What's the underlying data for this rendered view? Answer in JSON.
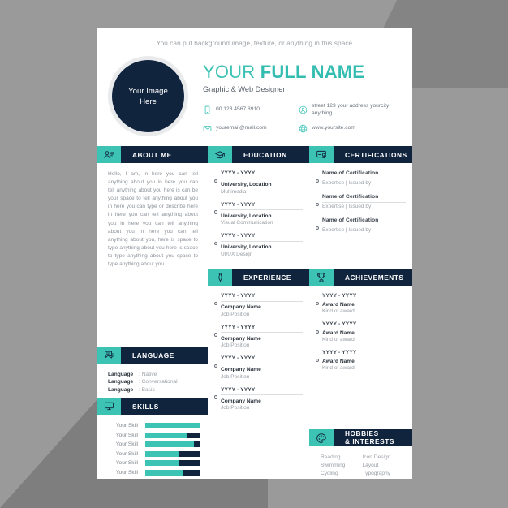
{
  "colors": {
    "teal": "#3cc3b4",
    "navy": "#11243e",
    "page_bg": "#ffffff",
    "backdrop": "#9a9a9a",
    "muted_text": "#9aa0a7"
  },
  "tagline": "You can put background image, texture, or anything in this space",
  "photo": {
    "line1": "Your Image",
    "line2": "Here"
  },
  "header": {
    "name_first": "YOUR",
    "name_last": "FULL NAME",
    "subtitle": "Graphic & Web Designer",
    "contacts": [
      {
        "icon": "phone-icon",
        "text": "00 123 4567 8910"
      },
      {
        "icon": "location-pin-icon",
        "text": "street 123 your address yourcity anything"
      },
      {
        "icon": "envelope-icon",
        "text": "youremail@mail.com"
      },
      {
        "icon": "globe-icon",
        "text": "www.yoursite.com"
      }
    ]
  },
  "sections": {
    "about": {
      "title": "ABOUT ME",
      "icon": "person-list-icon"
    },
    "education": {
      "title": "EDUCATION",
      "icon": "graduation-cap-icon"
    },
    "certifications": {
      "title": "CERTIFICATIONS",
      "icon": "certificate-icon"
    },
    "experience": {
      "title": "EXPERIENCE",
      "icon": "necktie-icon"
    },
    "achievements": {
      "title": "ACHIEVEMENTS",
      "icon": "trophy-icon"
    },
    "language": {
      "title": "LANGUAGE",
      "icon": "speech-bubble-icon"
    },
    "skills": {
      "title": "SKILLS",
      "icon": "monitor-icon"
    },
    "hobbies": {
      "title_line1": "HOBBIES",
      "title_line2": "& INTERESTS",
      "icon": "palette-icon"
    }
  },
  "about": {
    "text": "Hello, I am, in here you can tell anything about you in here you can tell anything about you here is can be your space to tell anything about you in here you can type or describe here in here you can tell anything about you in here you can tell anything about you in here you can tell anything about you, here is space to type anything about you here is space to type anything about you space to type anything about you."
  },
  "education": [
    {
      "date": "YYYY - YYYY",
      "title": "University, Location",
      "sub": "Multimedia"
    },
    {
      "date": "YYYY - YYYY",
      "title": "University, Location",
      "sub": "Visual Communication"
    },
    {
      "date": "YYYY - YYYY",
      "title": "University, Location",
      "sub": "UI/UX Design"
    }
  ],
  "certifications": [
    {
      "title": "Name of Certification",
      "sub": "Expertise | Issued by"
    },
    {
      "title": "Name of Certification",
      "sub": "Expertise | Issued by"
    },
    {
      "title": "Name of Certification",
      "sub": "Expertise | Issued by"
    }
  ],
  "experience": [
    {
      "date": "YYYY - YYYY",
      "title": "Company Name",
      "sub": "Job Position"
    },
    {
      "date": "YYYY - YYYY",
      "title": "Company Name",
      "sub": "Job Position"
    },
    {
      "date": "YYYY - YYYY",
      "title": "Company Name",
      "sub": "Job Position"
    },
    {
      "date": "YYYY - YYYY",
      "title": "Company Name",
      "sub": "Job Position"
    }
  ],
  "achievements": [
    {
      "date": "YYYY - YYYY",
      "title": "Award Name",
      "sub": "Kind of award"
    },
    {
      "date": "YYYY - YYYY",
      "title": "Award Name",
      "sub": "Kind of award"
    },
    {
      "date": "YYYY - YYYY",
      "title": "Award Name",
      "sub": "Kind of award"
    }
  ],
  "language": [
    {
      "name": "Language",
      "value": ": Native"
    },
    {
      "name": "Language",
      "value": ": Conversational"
    },
    {
      "name": "Language",
      "value": ": Basic"
    }
  ],
  "skills": [
    {
      "name": "Your Skill",
      "level": 100
    },
    {
      "name": "Your Skill",
      "level": 78
    },
    {
      "name": "Your Skill",
      "level": 89
    },
    {
      "name": "Your Skill",
      "level": 62
    },
    {
      "name": "Your Skill",
      "level": 62
    },
    {
      "name": "Your Skill",
      "level": 70
    }
  ],
  "hobbies": {
    "column1": [
      "Reading",
      "Swimming",
      "Cycling"
    ],
    "column2": [
      "Icon Design",
      "Layout",
      "Typography"
    ]
  }
}
